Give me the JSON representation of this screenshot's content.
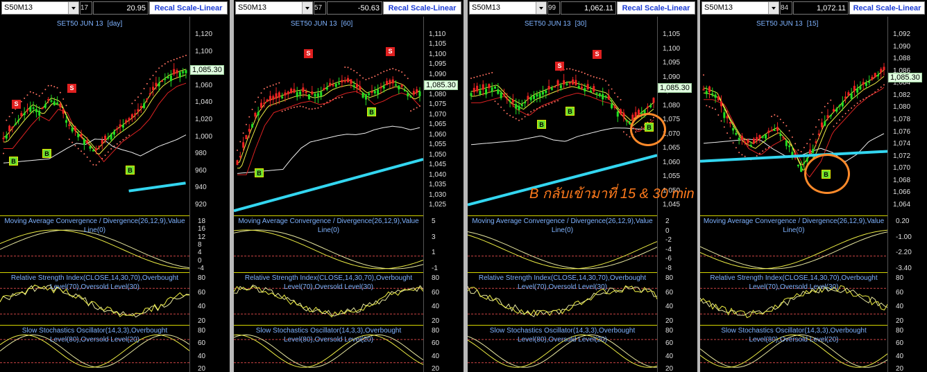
{
  "panels": [
    {
      "symbol": "S50M13",
      "count": "17",
      "value": "20.95",
      "recal_label": "Recal Scale-Linear",
      "title": "SET50 JUN 13",
      "timeframe": "[day]",
      "last_price": "1,085.30",
      "price_axis": [
        "1,120",
        "1,100",
        "1,080",
        "1,060",
        "1,040",
        "1,020",
        "1,000",
        "980",
        "960",
        "940",
        "920"
      ],
      "macd_title": "Moving Average Convergence / Divergence(26,12,9),Value Line(0)",
      "macd_axis": [
        "18",
        "16",
        "12",
        "8",
        "4",
        "0",
        "-4"
      ],
      "rsi_title": "Relative Strength Index(CLOSE,14,30,70),Overbought Level(70),Oversold Level(30)",
      "rsi_axis": [
        "80",
        "60",
        "40",
        "20"
      ],
      "stoch_title": "Slow Stochastics Oscillator(14,3,3),Overbought Level(80),Oversold Level(20)",
      "stoch_axis": [
        "80",
        "60",
        "40",
        "20"
      ]
    },
    {
      "symbol": "S50M13",
      "count": "57",
      "value": "-50.63",
      "recal_label": "Recal Scale-Linear",
      "title": "SET50 JUN 13",
      "timeframe": "[60]",
      "last_price": "1,085.30",
      "price_axis": [
        "1,110",
        "1,105",
        "1,100",
        "1,095",
        "1,090",
        "1,085",
        "1,080",
        "1,075",
        "1,070",
        "1,065",
        "1,060",
        "1,055",
        "1,050",
        "1,045",
        "1,040",
        "1,035",
        "1,030",
        "1,025"
      ],
      "macd_title": "Moving Average Convergence / Divergence(26,12,9),Value Line(0)",
      "macd_axis": [
        "5",
        "3",
        "1",
        "-1"
      ],
      "rsi_title": "Relative Strength Index(CLOSE,14,30,70),Overbought Level(70),Oversold Level(30)",
      "rsi_axis": [
        "80",
        "60",
        "40",
        "20"
      ],
      "stoch_title": "Slow Stochastics Oscillator(14,3,3),Overbought Level(80),Oversold Level(20)",
      "stoch_axis": [
        "80",
        "60",
        "40",
        "20"
      ]
    },
    {
      "symbol": "S50M13",
      "count": "99",
      "value": "1,062.11",
      "recal_label": "Recal Scale-Linear",
      "title": "SET50 JUN 13",
      "timeframe": "[30]",
      "last_price": "1,085.30",
      "price_axis": [
        "1,105",
        "1,100",
        "1,095",
        "1,090",
        "1,085",
        "1,080",
        "1,075",
        "1,070",
        "1,065",
        "1,060",
        "1,055",
        "1,050",
        "1,045"
      ],
      "macd_title": "Moving Average Convergence / Divergence(26,12,9),Value Line(0)",
      "macd_axis": [
        "2",
        "0",
        "-2",
        "-4",
        "-6",
        "-8"
      ],
      "rsi_title": "Relative Strength Index(CLOSE,14,30,70),Overbought Level(70),Oversold Level(30)",
      "rsi_axis": [
        "80",
        "60",
        "40",
        "20"
      ],
      "stoch_title": "Slow Stochastics Oscillator(14,3,3),Overbought Level(80),Oversold Level(20)",
      "stoch_axis": [
        "80",
        "60",
        "40",
        "20"
      ]
    },
    {
      "symbol": "S50M13",
      "count": "84",
      "value": "1,072.11",
      "recal_label": "Recal Scale-Linear",
      "title": "SET50 JUN 13",
      "timeframe": "[15]",
      "last_price": "1,085.30",
      "price_axis": [
        "1,092",
        "1,090",
        "1,088",
        "1,086",
        "1,084",
        "1,082",
        "1,080",
        "1,078",
        "1,076",
        "1,074",
        "1,072",
        "1,070",
        "1,068",
        "1,066",
        "1,064"
      ],
      "macd_title": "Moving Average Convergence / Divergence(26,12,9),Value Line(0)",
      "macd_axis": [
        "0.20",
        "-1.00",
        "-2.20",
        "-3.40"
      ],
      "rsi_title": "Relative Strength Index(CLOSE,14,30,70),Overbought Level(70),Oversold Level(30)",
      "rsi_axis": [
        "80",
        "60",
        "40",
        "20"
      ],
      "stoch_title": "Slow Stochastics Oscillator(14,3,3),Overbought Level(80),Oversold Level(20)",
      "stoch_axis": [
        "80",
        "60",
        "40",
        "20"
      ]
    }
  ],
  "signals": {
    "sell": "S",
    "buy": "B"
  },
  "annotation": "B กลับเข้ามาที่ 15 & 30 min",
  "colors": {
    "candle_up": "#22dd22",
    "candle_down": "#ee2222",
    "ma_fast": "#eeee44",
    "ma_mid": "#dd2222",
    "ma_slow": "#f0f0f0",
    "trend": "#33d6f0",
    "sar": "#ff7060",
    "highlight": "#ff8a2a",
    "title": "#7fb3ff"
  },
  "icons": {
    "dropdown": "chevron-down-icon"
  }
}
